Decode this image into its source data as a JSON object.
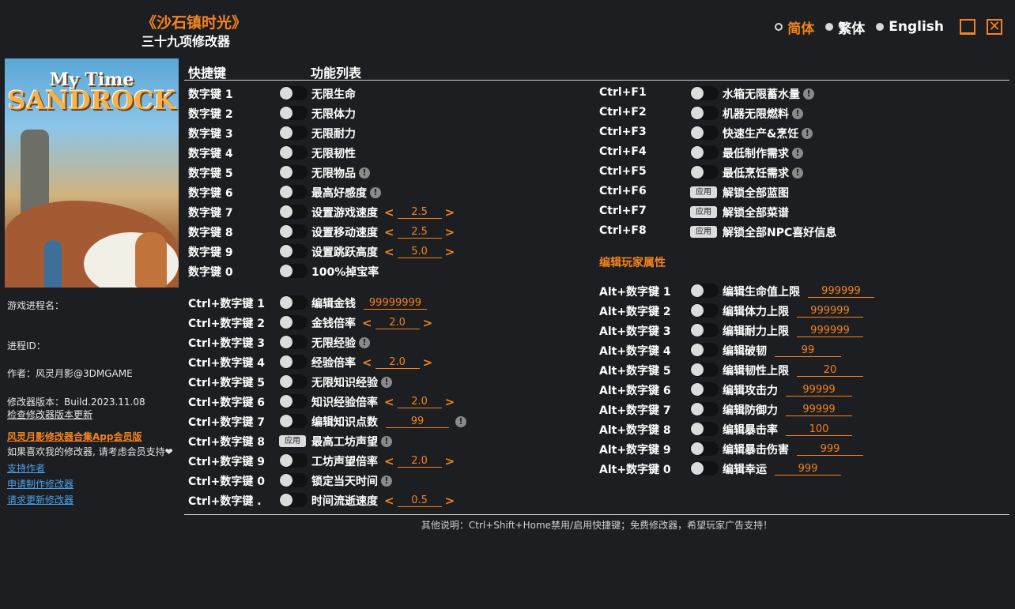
{
  "title": "《沙石镇时光》",
  "subtitle": "三十九项修改器",
  "languages": [
    {
      "label": "简体",
      "selected": true
    },
    {
      "label": "繁体",
      "selected": false
    },
    {
      "label": "English",
      "selected": false
    }
  ],
  "window": {
    "minimize_icon": "minimize-icon",
    "close_icon": "close-icon",
    "close_glyph": "✕"
  },
  "cover": {
    "logo_line1": "My Time",
    "logo_line2": "SANDROCK"
  },
  "info": {
    "process_name_label": "游戏进程名：",
    "process_id_label": "进程ID：",
    "author": "作者：风灵月影@3DMGAME",
    "version": "修改器版本：Build.2023.11.08",
    "check_update": "检查修改器版本更新",
    "app_promo": "风灵月影修改器合集App会员版",
    "support_text": "如果喜欢我的修改器, 请考虑会员支持❤",
    "link_support": "支持作者",
    "link_request": "申请制作修改器",
    "link_update": "请求更新修改器"
  },
  "headers": {
    "hotkey": "快捷键",
    "features": "功能列表"
  },
  "apply_label": "应用",
  "left_rows": [
    {
      "key": "数字键 1",
      "name": "无限生命",
      "control": "toggle"
    },
    {
      "key": "数字键 2",
      "name": "无限体力",
      "control": "toggle"
    },
    {
      "key": "数字键 3",
      "name": "无限耐力",
      "control": "toggle"
    },
    {
      "key": "数字键 4",
      "name": "无限韧性",
      "control": "toggle"
    },
    {
      "key": "数字键 5",
      "name": "无限物品",
      "control": "toggle",
      "warn": true
    },
    {
      "key": "数字键 6",
      "name": "最高好感度",
      "control": "toggle",
      "warn": true
    },
    {
      "key": "数字键 7",
      "name": "设置游戏速度",
      "control": "toggle",
      "stepper": "2.5"
    },
    {
      "key": "数字键 8",
      "name": "设置移动速度",
      "control": "toggle",
      "stepper": "2.5"
    },
    {
      "key": "数字键 9",
      "name": "设置跳跃高度",
      "control": "toggle",
      "stepper": "5.0"
    },
    {
      "key": "数字键 0",
      "name": "100%掉宝率",
      "control": "toggle"
    },
    {
      "key": "Ctrl+数字键 1",
      "name": "编辑金钱",
      "control": "toggle",
      "input": "99999999"
    },
    {
      "key": "Ctrl+数字键 2",
      "name": "金钱倍率",
      "control": "toggle",
      "stepper": "2.0"
    },
    {
      "key": "Ctrl+数字键 3",
      "name": "无限经验",
      "control": "toggle",
      "warn": true
    },
    {
      "key": "Ctrl+数字键 4",
      "name": "经验倍率",
      "control": "toggle",
      "stepper": "2.0"
    },
    {
      "key": "Ctrl+数字键 5",
      "name": "无限知识经验",
      "control": "toggle",
      "warn": true
    },
    {
      "key": "Ctrl+数字键 6",
      "name": "知识经验倍率",
      "control": "toggle",
      "stepper": "2.0"
    },
    {
      "key": "Ctrl+数字键 7",
      "name": "编辑知识点数",
      "control": "toggle",
      "input": "99",
      "warn_after": true
    },
    {
      "key": "Ctrl+数字键 8",
      "name": "最高工坊声望",
      "control": "apply",
      "warn": true
    },
    {
      "key": "Ctrl+数字键 9",
      "name": "工坊声望倍率",
      "control": "toggle",
      "stepper": "2.0"
    },
    {
      "key": "Ctrl+数字键 0",
      "name": "锁定当天时间",
      "control": "toggle",
      "warn": true
    },
    {
      "key": "Ctrl+数字键 .",
      "name": "时间流逝速度",
      "control": "toggle",
      "stepper": "0.5"
    }
  ],
  "right_rows_top": [
    {
      "key": "Ctrl+F1",
      "name": "水箱无限蓄水量",
      "control": "toggle",
      "warn": true
    },
    {
      "key": "Ctrl+F2",
      "name": "机器无限燃料",
      "control": "toggle",
      "warn": true
    },
    {
      "key": "Ctrl+F3",
      "name": "快速生产&烹饪",
      "control": "toggle",
      "warn": true
    },
    {
      "key": "Ctrl+F4",
      "name": "最低制作需求",
      "control": "toggle",
      "warn": true
    },
    {
      "key": "Ctrl+F5",
      "name": "最低烹饪需求",
      "control": "toggle",
      "warn": true
    },
    {
      "key": "Ctrl+F6",
      "name": "解锁全部蓝图",
      "control": "apply"
    },
    {
      "key": "Ctrl+F7",
      "name": "解锁全部菜谱",
      "control": "apply"
    },
    {
      "key": "Ctrl+F8",
      "name": "解锁全部NPC喜好信息",
      "control": "apply"
    }
  ],
  "section_player": "编辑玩家属性",
  "right_rows_bottom": [
    {
      "key": "Alt+数字键 1",
      "name": "编辑生命值上限",
      "control": "toggle",
      "input": "999999"
    },
    {
      "key": "Alt+数字键 2",
      "name": "编辑体力上限",
      "control": "toggle",
      "input": "999999"
    },
    {
      "key": "Alt+数字键 3",
      "name": "编辑耐力上限",
      "control": "toggle",
      "input": "999999"
    },
    {
      "key": "Alt+数字键 4",
      "name": "编辑破韧",
      "control": "toggle",
      "input": "99"
    },
    {
      "key": "Alt+数字键 5",
      "name": "编辑韧性上限",
      "control": "toggle",
      "input": "20"
    },
    {
      "key": "Alt+数字键 6",
      "name": "编辑攻击力",
      "control": "toggle",
      "input": "99999"
    },
    {
      "key": "Alt+数字键 7",
      "name": "编辑防御力",
      "control": "toggle",
      "input": "99999"
    },
    {
      "key": "Alt+数字键 8",
      "name": "编辑暴击率",
      "control": "toggle",
      "input": "100"
    },
    {
      "key": "Alt+数字键 9",
      "name": "编辑暴击伤害",
      "control": "toggle",
      "input": "999"
    },
    {
      "key": "Alt+数字键 0",
      "name": "编辑幸运",
      "control": "toggle",
      "input": "999"
    }
  ],
  "footer": "其他说明：Ctrl+Shift+Home禁用/启用快捷键；免费修改器，希望玩家广告支持！",
  "colors": {
    "accent": "#f5831f",
    "bg": "#1c1e21",
    "link": "#4aa3f0"
  }
}
